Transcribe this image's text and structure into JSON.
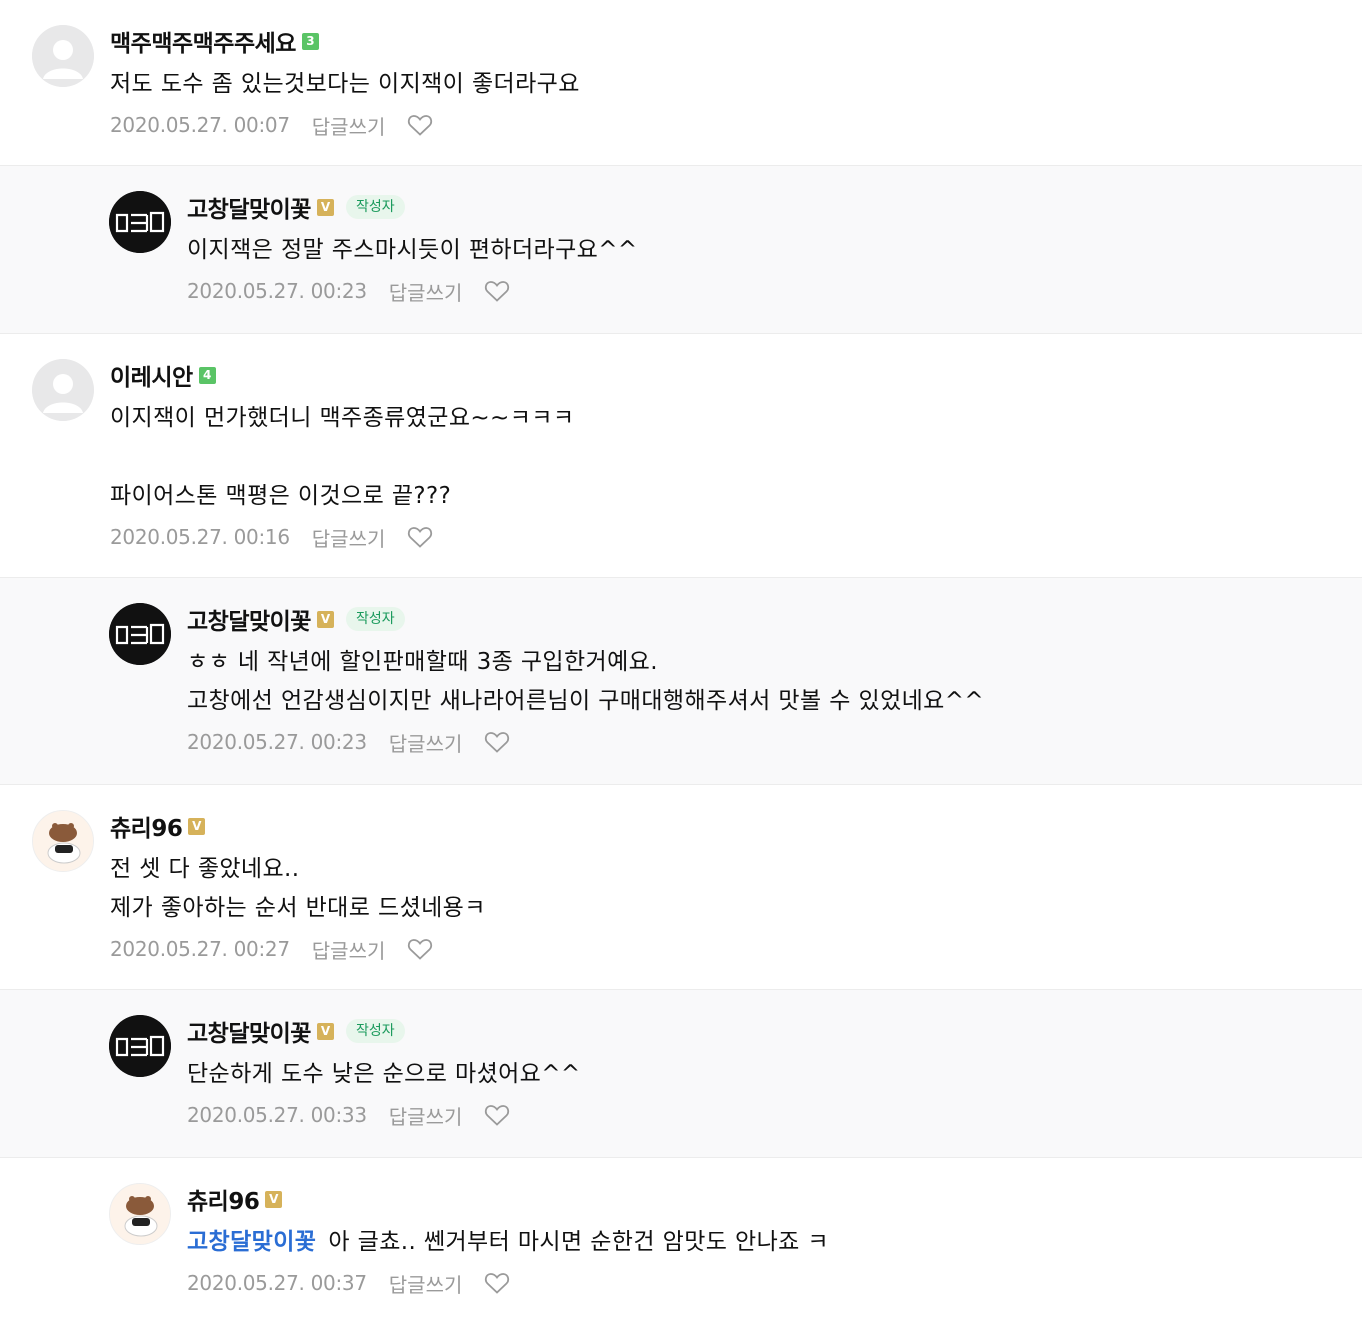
{
  "comments": [
    {
      "nickname": "맥주맥주맥주주세요",
      "grade": "3",
      "lines": [
        "저도 도수 좀 있는것보다는 이지잭이 좋더라구요"
      ],
      "date": "2020.05.27. 00:07",
      "reply_label": "답글쓰기"
    },
    {
      "nickname": "고창달맞이꽃",
      "grade": "V",
      "author_label": "작성자",
      "lines": [
        "이지잭은 정말 주스마시듯이 편하더라구요^^"
      ],
      "date": "2020.05.27. 00:23",
      "reply_label": "답글쓰기"
    },
    {
      "nickname": "이레시안",
      "grade": "4",
      "lines": [
        "이지잭이 먼가했더니 맥주종류였군요~~ㅋㅋㅋ",
        "",
        "파이어스톤 맥평은 이것으로 끝???"
      ],
      "date": "2020.05.27. 00:16",
      "reply_label": "답글쓰기"
    },
    {
      "nickname": "고창달맞이꽃",
      "grade": "V",
      "author_label": "작성자",
      "lines": [
        "ㅎㅎ 네 작년에 할인판매할때 3종 구입한거예요.",
        "고창에선 언감생심이지만 새나라어른님이 구매대행해주셔서 맛볼 수 있었네요^^"
      ],
      "date": "2020.05.27. 00:23",
      "reply_label": "답글쓰기"
    },
    {
      "nickname": "츄리96",
      "grade": "V",
      "lines": [
        "전 셋 다 좋았네요..",
        "제가 좋아하는 순서 반대로 드셨네용ㅋ"
      ],
      "date": "2020.05.27. 00:27",
      "reply_label": "답글쓰기"
    },
    {
      "nickname": "고창달맞이꽃",
      "grade": "V",
      "author_label": "작성자",
      "lines": [
        "단순하게 도수 낮은 순으로 마셨어요^^"
      ],
      "date": "2020.05.27. 00:33",
      "reply_label": "답글쓰기"
    },
    {
      "nickname": "츄리96",
      "grade": "V",
      "mention": "고창달맞이꽃",
      "lines": [
        "아 글쵸.. 쎈거부터 마시면 순한건 암맛도 안나죠 ㅋ"
      ],
      "date": "2020.05.27. 00:37",
      "reply_label": "답글쓰기"
    }
  ],
  "colors": {
    "grade_number": "#5ac466",
    "grade_v": "#d6b25a",
    "author_badge_text": "#1a9a5c",
    "mention": "#2a6dd4",
    "meta_text": "#9a9a9a",
    "reply_background": "#f9f9fa"
  },
  "icons": {
    "default_avatar": "default-profile-icon",
    "logo_avatar": "gomdol-logo-icon",
    "bear_avatar": "bear-character-icon",
    "like": "heart-outline-icon"
  }
}
